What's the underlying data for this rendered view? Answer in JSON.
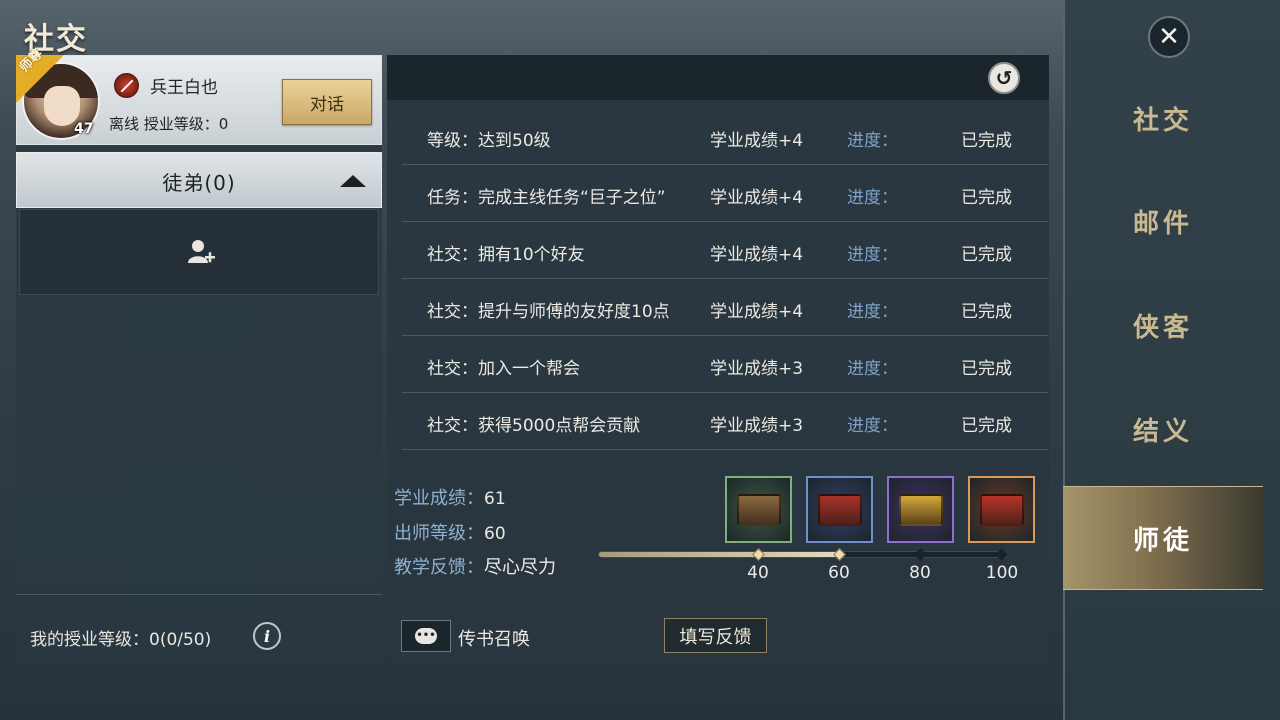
{
  "window": {
    "title": "社交",
    "close_icon": "close-icon"
  },
  "right_nav": [
    {
      "label": "社交",
      "active": false
    },
    {
      "label": "邮件",
      "active": false
    },
    {
      "label": "侠客",
      "active": false
    },
    {
      "label": "结义",
      "active": false
    },
    {
      "label": "师徒",
      "active": true
    }
  ],
  "master": {
    "ribbon": "师尊",
    "name": "兵王白也",
    "level": "47",
    "status": "离线 授业等级：0",
    "talk_button": "对话"
  },
  "disciples": {
    "title": "徒弟(0)",
    "add_icon": "add-user-icon"
  },
  "my_level": "我的授业等级：0(0/50)",
  "tasks": [
    {
      "name": "等级：达到50级",
      "reward": "学业成绩+4",
      "progress_label": "进度：",
      "state": "已完成"
    },
    {
      "name": "任务：完成主线任务“巨子之位”",
      "reward": "学业成绩+4",
      "progress_label": "进度：",
      "state": "已完成"
    },
    {
      "name": "社交：拥有10个好友",
      "reward": "学业成绩+4",
      "progress_label": "进度：",
      "state": "已完成"
    },
    {
      "name": "社交：提升与师傅的友好度10点",
      "reward": "学业成绩+4",
      "progress_label": "进度：",
      "state": "已完成"
    },
    {
      "name": "社交：加入一个帮会",
      "reward": "学业成绩+3",
      "progress_label": "进度：",
      "state": "已完成"
    },
    {
      "name": "社交：获得5000点帮会贡献",
      "reward": "学业成绩+3",
      "progress_label": "进度：",
      "state": "已完成"
    }
  ],
  "stats": {
    "score_label": "学业成绩：",
    "score_value": "61",
    "graduate_label": "出师等级：",
    "graduate_value": "60",
    "feedback_label": "教学反馈：",
    "feedback_value": "尽心尽力"
  },
  "rewards": [
    {
      "tier": "40",
      "frame_color": "#7fb07a",
      "bg": "#3f5a44",
      "box_color": "#8a6a3e"
    },
    {
      "tier": "60",
      "frame_color": "#6f8fcf",
      "bg": "#2e3f6a",
      "box_color": "#a8322a"
    },
    {
      "tier": "80",
      "frame_color": "#8e6fcf",
      "bg": "#3e2f68",
      "box_color": "#d4a83a"
    },
    {
      "tier": "100",
      "frame_color": "#d89a5a",
      "bg": "#6a3b22",
      "box_color": "#b8342a"
    }
  ],
  "progress": {
    "value": 61,
    "max": 100
  },
  "progress_ticks": [
    "40",
    "60",
    "80",
    "100"
  ],
  "footer": {
    "summon_label": "传书召唤",
    "feedback_button": "填写反馈"
  },
  "colors": {
    "accent_gold": "#c9b991",
    "progress_text": "#7fa4c8"
  }
}
